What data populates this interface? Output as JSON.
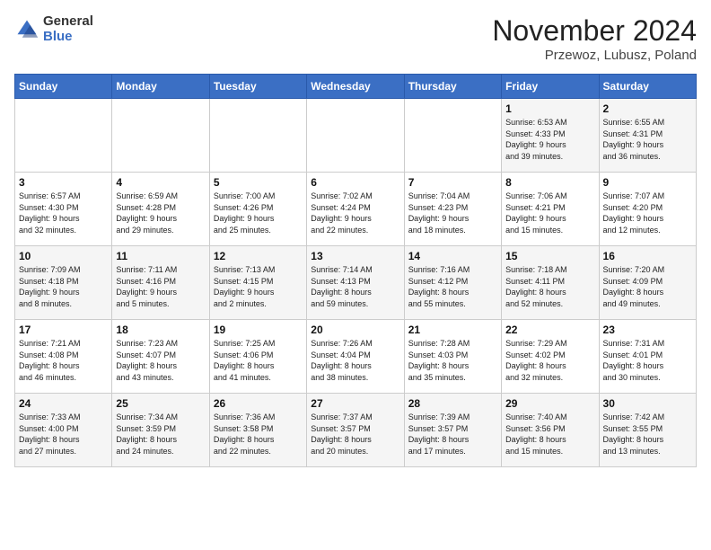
{
  "logo": {
    "general": "General",
    "blue": "Blue"
  },
  "header": {
    "month": "November 2024",
    "location": "Przewoz, Lubusz, Poland"
  },
  "weekdays": [
    "Sunday",
    "Monday",
    "Tuesday",
    "Wednesday",
    "Thursday",
    "Friday",
    "Saturday"
  ],
  "weeks": [
    [
      {
        "day": "",
        "info": ""
      },
      {
        "day": "",
        "info": ""
      },
      {
        "day": "",
        "info": ""
      },
      {
        "day": "",
        "info": ""
      },
      {
        "day": "",
        "info": ""
      },
      {
        "day": "1",
        "info": "Sunrise: 6:53 AM\nSunset: 4:33 PM\nDaylight: 9 hours\nand 39 minutes."
      },
      {
        "day": "2",
        "info": "Sunrise: 6:55 AM\nSunset: 4:31 PM\nDaylight: 9 hours\nand 36 minutes."
      }
    ],
    [
      {
        "day": "3",
        "info": "Sunrise: 6:57 AM\nSunset: 4:30 PM\nDaylight: 9 hours\nand 32 minutes."
      },
      {
        "day": "4",
        "info": "Sunrise: 6:59 AM\nSunset: 4:28 PM\nDaylight: 9 hours\nand 29 minutes."
      },
      {
        "day": "5",
        "info": "Sunrise: 7:00 AM\nSunset: 4:26 PM\nDaylight: 9 hours\nand 25 minutes."
      },
      {
        "day": "6",
        "info": "Sunrise: 7:02 AM\nSunset: 4:24 PM\nDaylight: 9 hours\nand 22 minutes."
      },
      {
        "day": "7",
        "info": "Sunrise: 7:04 AM\nSunset: 4:23 PM\nDaylight: 9 hours\nand 18 minutes."
      },
      {
        "day": "8",
        "info": "Sunrise: 7:06 AM\nSunset: 4:21 PM\nDaylight: 9 hours\nand 15 minutes."
      },
      {
        "day": "9",
        "info": "Sunrise: 7:07 AM\nSunset: 4:20 PM\nDaylight: 9 hours\nand 12 minutes."
      }
    ],
    [
      {
        "day": "10",
        "info": "Sunrise: 7:09 AM\nSunset: 4:18 PM\nDaylight: 9 hours\nand 8 minutes."
      },
      {
        "day": "11",
        "info": "Sunrise: 7:11 AM\nSunset: 4:16 PM\nDaylight: 9 hours\nand 5 minutes."
      },
      {
        "day": "12",
        "info": "Sunrise: 7:13 AM\nSunset: 4:15 PM\nDaylight: 9 hours\nand 2 minutes."
      },
      {
        "day": "13",
        "info": "Sunrise: 7:14 AM\nSunset: 4:13 PM\nDaylight: 8 hours\nand 59 minutes."
      },
      {
        "day": "14",
        "info": "Sunrise: 7:16 AM\nSunset: 4:12 PM\nDaylight: 8 hours\nand 55 minutes."
      },
      {
        "day": "15",
        "info": "Sunrise: 7:18 AM\nSunset: 4:11 PM\nDaylight: 8 hours\nand 52 minutes."
      },
      {
        "day": "16",
        "info": "Sunrise: 7:20 AM\nSunset: 4:09 PM\nDaylight: 8 hours\nand 49 minutes."
      }
    ],
    [
      {
        "day": "17",
        "info": "Sunrise: 7:21 AM\nSunset: 4:08 PM\nDaylight: 8 hours\nand 46 minutes."
      },
      {
        "day": "18",
        "info": "Sunrise: 7:23 AM\nSunset: 4:07 PM\nDaylight: 8 hours\nand 43 minutes."
      },
      {
        "day": "19",
        "info": "Sunrise: 7:25 AM\nSunset: 4:06 PM\nDaylight: 8 hours\nand 41 minutes."
      },
      {
        "day": "20",
        "info": "Sunrise: 7:26 AM\nSunset: 4:04 PM\nDaylight: 8 hours\nand 38 minutes."
      },
      {
        "day": "21",
        "info": "Sunrise: 7:28 AM\nSunset: 4:03 PM\nDaylight: 8 hours\nand 35 minutes."
      },
      {
        "day": "22",
        "info": "Sunrise: 7:29 AM\nSunset: 4:02 PM\nDaylight: 8 hours\nand 32 minutes."
      },
      {
        "day": "23",
        "info": "Sunrise: 7:31 AM\nSunset: 4:01 PM\nDaylight: 8 hours\nand 30 minutes."
      }
    ],
    [
      {
        "day": "24",
        "info": "Sunrise: 7:33 AM\nSunset: 4:00 PM\nDaylight: 8 hours\nand 27 minutes."
      },
      {
        "day": "25",
        "info": "Sunrise: 7:34 AM\nSunset: 3:59 PM\nDaylight: 8 hours\nand 24 minutes."
      },
      {
        "day": "26",
        "info": "Sunrise: 7:36 AM\nSunset: 3:58 PM\nDaylight: 8 hours\nand 22 minutes."
      },
      {
        "day": "27",
        "info": "Sunrise: 7:37 AM\nSunset: 3:57 PM\nDaylight: 8 hours\nand 20 minutes."
      },
      {
        "day": "28",
        "info": "Sunrise: 7:39 AM\nSunset: 3:57 PM\nDaylight: 8 hours\nand 17 minutes."
      },
      {
        "day": "29",
        "info": "Sunrise: 7:40 AM\nSunset: 3:56 PM\nDaylight: 8 hours\nand 15 minutes."
      },
      {
        "day": "30",
        "info": "Sunrise: 7:42 AM\nSunset: 3:55 PM\nDaylight: 8 hours\nand 13 minutes."
      }
    ]
  ]
}
